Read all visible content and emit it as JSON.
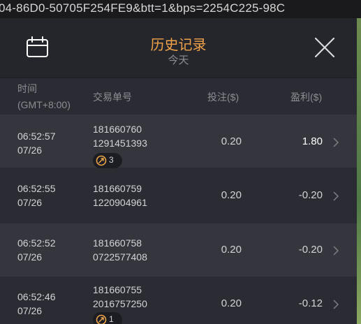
{
  "browser": {
    "url_fragment": "04-86D0-50705F254FE9&btt=1&bps=2254C225-98C"
  },
  "header": {
    "title": "历史记录",
    "subtitle": "今天"
  },
  "columns": {
    "time_line1": "时间",
    "time_line2": "(GMT+8:00)",
    "order": "交易单号",
    "stake": "投注($)",
    "pnl": "盈利($)"
  },
  "rows": [
    {
      "time": "06:52:57",
      "date": "07/26",
      "order1": "181660760",
      "order2": "1291451393",
      "badge": "3",
      "stake": "0.20",
      "pnl": "1.80"
    },
    {
      "time": "06:52:55",
      "date": "07/26",
      "order1": "181660759",
      "order2": "1220904961",
      "stake": "0.20",
      "pnl": "-0.20"
    },
    {
      "time": "06:52:52",
      "date": "07/26",
      "order1": "181660758",
      "order2": "0722577408",
      "stake": "0.20",
      "pnl": "-0.20"
    },
    {
      "time": "06:52:46",
      "date": "07/26",
      "order1": "181660755",
      "order2": "2016757250",
      "badge": "1",
      "stake": "0.20",
      "pnl": "-0.12"
    }
  ],
  "icons": {
    "calendar": "calendar-icon",
    "close": "close-icon",
    "row_chevron": "chevron-right-icon",
    "badge": "spin-icon"
  },
  "colors": {
    "accent": "#f0a24a",
    "background": "#2b2c33",
    "header": "#25262c",
    "row_alt": "#35363d",
    "badge_ring": "#e9a34b"
  }
}
